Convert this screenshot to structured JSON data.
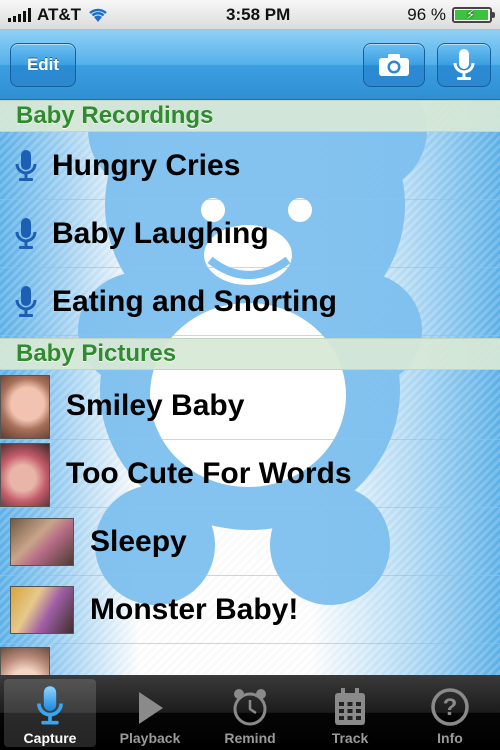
{
  "status_bar": {
    "carrier": "AT&T",
    "time": "3:58 PM",
    "battery_percent_label": "96 %",
    "battery_level": 0.96
  },
  "nav_bar": {
    "edit_label": "Edit",
    "camera_icon": "camera-icon",
    "mic_icon": "microphone-icon"
  },
  "sections": {
    "recordings": {
      "title": "Baby Recordings",
      "items": [
        {
          "label": "Hungry Cries"
        },
        {
          "label": "Baby Laughing"
        },
        {
          "label": "Eating and Snorting"
        }
      ]
    },
    "pictures": {
      "title": "Baby Pictures",
      "items": [
        {
          "label": "Smiley Baby"
        },
        {
          "label": "Too Cute For Words"
        },
        {
          "label": "Sleepy"
        },
        {
          "label": "Monster Baby!"
        }
      ]
    }
  },
  "tabs": [
    {
      "label": "Capture",
      "icon": "microphone-icon",
      "active": true
    },
    {
      "label": "Playback",
      "icon": "play-icon",
      "active": false
    },
    {
      "label": "Remind",
      "icon": "alarm-clock-icon",
      "active": false
    },
    {
      "label": "Track",
      "icon": "calendar-icon",
      "active": false
    },
    {
      "label": "Info",
      "icon": "help-icon",
      "active": false
    }
  ],
  "colors": {
    "nav_blue": "#3c9fe0",
    "section_green": "#2f8b2d",
    "bear_blue": "#7ec0ef"
  }
}
